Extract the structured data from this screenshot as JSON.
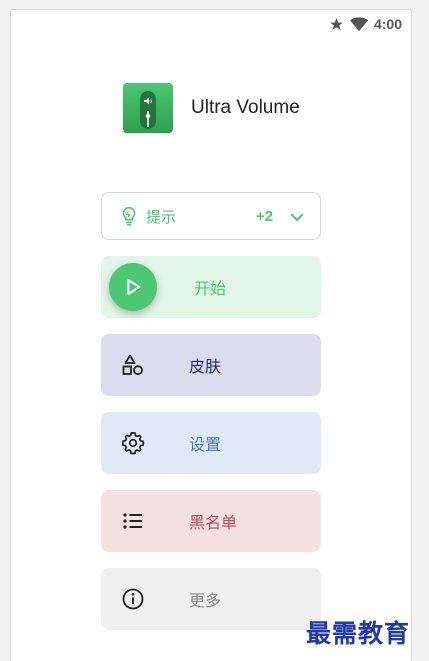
{
  "status_bar": {
    "time": "4:00",
    "icons": [
      "star-icon",
      "wifi-icon"
    ]
  },
  "app": {
    "name": "Ultra Volume",
    "icon": "volume-slider-app-icon"
  },
  "tips": {
    "label": "提示",
    "count": "+2",
    "icon": "lightbulb-icon",
    "expand_icon": "chevron-down-icon"
  },
  "menu": {
    "start": {
      "label": "开始",
      "icon": "play-icon"
    },
    "skin": {
      "label": "皮肤",
      "icon": "shapes-icon"
    },
    "settings": {
      "label": "设置",
      "icon": "gear-icon"
    },
    "blacklist": {
      "label": "黑名单",
      "icon": "list-icon"
    },
    "more": {
      "label": "更多",
      "icon": "info-icon"
    }
  },
  "colors": {
    "accent": "#4cc772",
    "skin_bg": "#dcdcef",
    "skin_text": "#1b2a6e",
    "settings_bg": "#e0e9f6",
    "settings_text": "#4e7bb9",
    "blacklist_bg": "#f6e1e1",
    "blacklist_text": "#c4474a",
    "more_bg": "#efefef",
    "more_text": "#8a8a8a"
  },
  "watermark": "最需教育"
}
